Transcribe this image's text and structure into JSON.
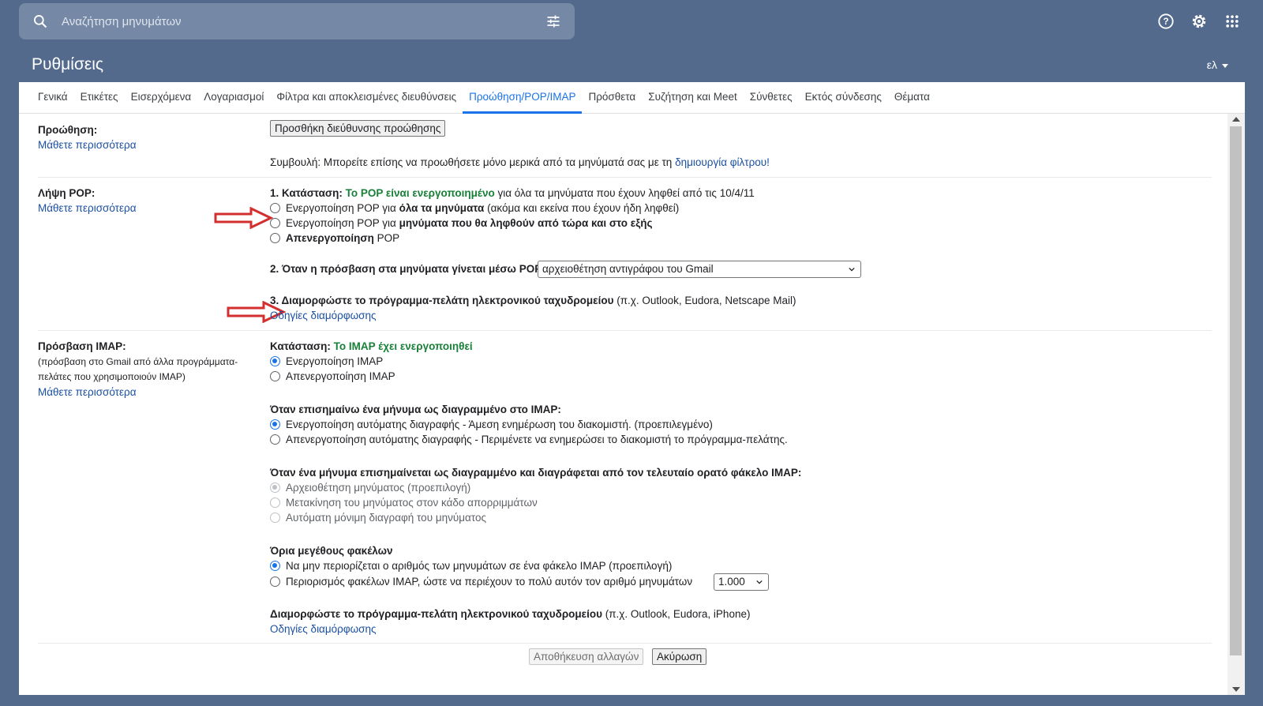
{
  "search": {
    "placeholder": "Αναζήτηση μηνυμάτων"
  },
  "header": {
    "title": "Ρυθμίσεις",
    "lang": "ελ"
  },
  "tabs": [
    {
      "label": "Γενικά"
    },
    {
      "label": "Ετικέτες"
    },
    {
      "label": "Εισερχόμενα"
    },
    {
      "label": "Λογαριασμοί"
    },
    {
      "label": "Φίλτρα και αποκλεισμένες διευθύνσεις"
    },
    {
      "label": "Προώθηση/POP/IMAP"
    },
    {
      "label": "Πρόσθετα"
    },
    {
      "label": "Συζήτηση και Meet"
    },
    {
      "label": "Σύνθετες"
    },
    {
      "label": "Εκτός σύνδεσης"
    },
    {
      "label": "Θέματα"
    }
  ],
  "active_tab": "Προώθηση/POP/IMAP",
  "forwarding": {
    "label": "Προώθηση:",
    "learn_more": "Μάθετε περισσότερα",
    "add_button": "Προσθήκη διεύθυνσης προώθησης",
    "tip_prefix": "Συμβουλή: Μπορείτε επίσης να προωθήσετε μόνο μερικά από τα μηνύματά σας με τη",
    "tip_link": "δημιουργία φίλτρου!"
  },
  "pop": {
    "label": "Λήψη POP:",
    "learn_more": "Μάθετε περισσότερα",
    "status_prefix": "1. Κατάσταση:",
    "status_value": "Το POP είναι ενεργοποιημένο",
    "status_suffix": "για όλα τα μηνύματα που έχουν ληφθεί από τις 10/4/11",
    "opt1_a": "Ενεργοποίηση POP για",
    "opt1_b": "όλα τα μηνύματα",
    "opt1_c": "(ακόμα και εκείνα που έχουν ήδη ληφθεί)",
    "opt2_a": "Ενεργοποίηση POP για",
    "opt2_b": "μηνύματα που θα ληφθούν από τώρα και στο εξής",
    "opt3_a": "Απενεργοποίηση",
    "opt3_b": "POP",
    "access_label": "2. Όταν η πρόσβαση στα μηνύματα γίνεται μέσω POP",
    "access_value": "αρχειοθέτηση αντιγράφου του Gmail",
    "client_label": "3. Διαμορφώστε το πρόγραμμα-πελάτη ηλεκτρονικού ταχυδρομείου",
    "client_hint": "(π.χ. Outlook, Eudora, Netscape Mail)",
    "instructions": "Οδηγίες διαμόρφωσης"
  },
  "imap": {
    "label": "Πρόσβαση IMAP:",
    "desc": "(πρόσβαση στο Gmail από άλλα προγράμματα-πελάτες που χρησιμοποιούν IMAP)",
    "learn_more": "Μάθετε περισσότερα",
    "status_prefix": "Κατάσταση:",
    "status_value": "Το IMAP έχει ενεργοποιηθεί",
    "enable": "Ενεργοποίηση IMAP",
    "disable": "Απενεργοποίηση IMAP",
    "deleted_title": "Όταν επισημαίνω ένα μήνυμα ως διαγραμμένο στο IMAP:",
    "autoexpunge_on": "Ενεργοποίηση αυτόματης διαγραφής - Άμεση ενημέρωση του διακομιστή. (προεπιλεγμένο)",
    "autoexpunge_off": "Απενεργοποίηση αυτόματης διαγραφής - Περιμένετε να ενημερώσει το διακομιστή το πρόγραμμα-πελάτης.",
    "expunged_title": "Όταν ένα μήνυμα επισημαίνεται ως διαγραμμένο και διαγράφεται από τον τελευταίο ορατό φάκελο IMAP:",
    "expunged_archive": "Αρχειοθέτηση μηνύματος (προεπιλογή)",
    "expunged_trash": "Μετακίνηση του μηνύματος στον κάδο απορριμμάτων",
    "expunged_delete": "Αυτόματη μόνιμη διαγραφή του μηνύματος",
    "limits_title": "Όρια μεγέθους φακέλων",
    "limits_none": "Να μην περιορίζεται ο αριθμός των μηνυμάτων σε ένα φάκελο IMAP (προεπιλογή)",
    "limits_some": "Περιορισμός φακέλων IMAP, ώστε να περιέχουν το πολύ αυτόν τον αριθμό μηνυμάτων",
    "limits_value": "1.000",
    "client_label": "Διαμορφώστε το πρόγραμμα-πελάτη ηλεκτρονικού ταχυδρομείου",
    "client_hint": "(π.χ. Outlook, Eudora, iPhone)",
    "instructions": "Οδηγίες διαμόρφωσης"
  },
  "footer": {
    "save": "Αποθήκευση αλλαγών",
    "cancel": "Ακύρωση"
  },
  "colors": {
    "accent": "#1a73e8",
    "status_green": "#188038",
    "annotation_arrow": "#d32f2f",
    "background": "#536a8c"
  }
}
